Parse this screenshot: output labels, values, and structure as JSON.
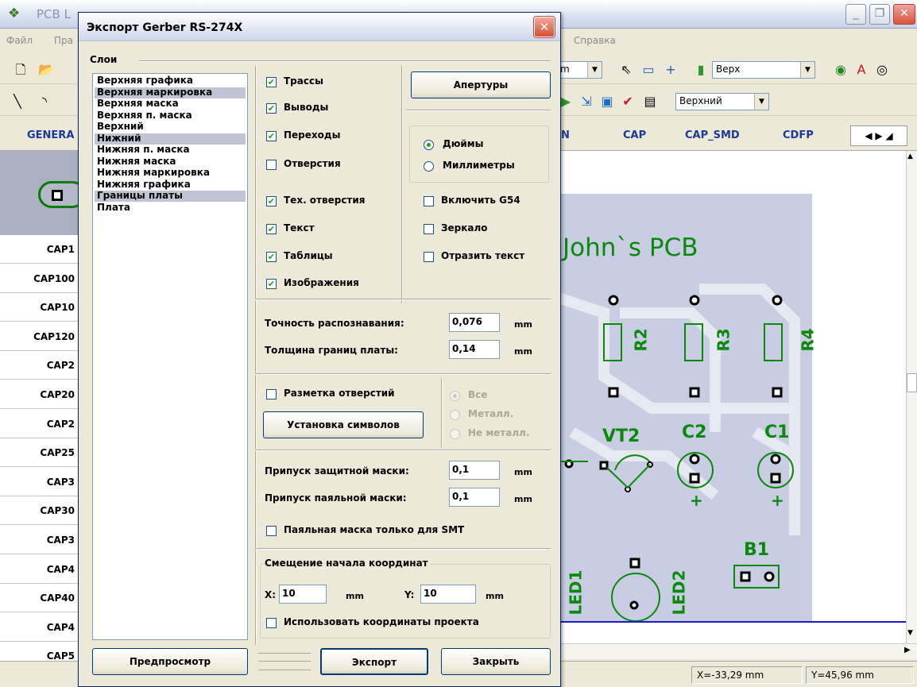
{
  "app": {
    "title": "PCB L",
    "menu": [
      "Файл",
      "Пра",
      "Справка"
    ],
    "toolbar": {
      "units_combo": "m",
      "side_combo": "Верх",
      "layer_combo": "Верхний"
    },
    "libtabs": [
      "GENERA",
      "N",
      "CAP",
      "CAP_SMD",
      "CDFP"
    ],
    "components": [
      "CAP1",
      "CAP100",
      "CAP10",
      "CAP120",
      "CAP2",
      "CAP20",
      "CAP2",
      "CAP25",
      "CAP3",
      "CAP30",
      "CAP3",
      "CAP4",
      "CAP40",
      "CAP4",
      "CAP5"
    ],
    "board": {
      "title": "John`s PCB",
      "refs": [
        "R2",
        "R3",
        "R4",
        "VT2",
        "C2",
        "C1",
        "B1",
        "LED1",
        "LED2"
      ],
      "polarity": "+"
    },
    "status": {
      "x": "X=-33,29 mm",
      "y": "Y=45,96 mm"
    }
  },
  "dialog": {
    "title": "Экспорт Gerber RS-274X",
    "close_glyph": "✕",
    "layers_label": "Слои",
    "layers": [
      {
        "name": "Верхняя графика",
        "selected": false
      },
      {
        "name": "Верхняя маркировка",
        "selected": true
      },
      {
        "name": "Верхняя маска",
        "selected": false
      },
      {
        "name": "Верхняя п. маска",
        "selected": false
      },
      {
        "name": "Верхний",
        "selected": false
      },
      {
        "name": "Нижний",
        "selected": true
      },
      {
        "name": "Нижняя п. маска",
        "selected": false
      },
      {
        "name": "Нижняя маска",
        "selected": false
      },
      {
        "name": "Нижняя маркировка",
        "selected": false
      },
      {
        "name": "Нижняя графика",
        "selected": false
      },
      {
        "name": "Границы платы",
        "selected": true
      },
      {
        "name": "Плата",
        "selected": false
      }
    ],
    "objects": [
      {
        "label": "Трассы",
        "checked": true
      },
      {
        "label": "Выводы",
        "checked": true
      },
      {
        "label": "Переходы",
        "checked": true
      },
      {
        "label": "Отверстия",
        "checked": false
      },
      {
        "label": "Тех. отверстия",
        "checked": true
      },
      {
        "label": "Текст",
        "checked": true
      },
      {
        "label": "Таблицы",
        "checked": true
      },
      {
        "label": "Изображения",
        "checked": true
      }
    ],
    "apertures_button": "Апертуры",
    "units": {
      "inches": "Дюймы",
      "millimeters": "Миллиметры",
      "selected": "inches"
    },
    "options": [
      {
        "label": "Включить G54",
        "checked": false
      },
      {
        "label": "Зеркало",
        "checked": false
      },
      {
        "label": "Отразить текст",
        "checked": false
      }
    ],
    "precision": {
      "label": "Точность распознавания:",
      "value": "0,076",
      "unit": "mm"
    },
    "border_width": {
      "label": "Толщина границ платы:",
      "value": "0,14",
      "unit": "mm"
    },
    "hole_marks": {
      "label": "Разметка отверстий",
      "checked": false,
      "symbols_button": "Установка символов",
      "radios": [
        "Все",
        "Металл.",
        "Не металл."
      ]
    },
    "solder_mask_clearance": {
      "label": "Припуск защитной маски:",
      "value": "0,1",
      "unit": "mm"
    },
    "paste_mask_clearance": {
      "label": "Припуск паяльной маски:",
      "value": "0,1",
      "unit": "mm"
    },
    "paste_smt_only": {
      "label": "Паяльная маска только для SMT",
      "checked": false
    },
    "offset": {
      "label": "Смещение начала координат",
      "x_label": "X:",
      "x_value": "10",
      "x_unit": "mm",
      "y_label": "Y:",
      "y_value": "10",
      "y_unit": "mm",
      "use_project": {
        "label": "Использовать координаты проекта",
        "checked": false
      }
    },
    "buttons": {
      "preview": "Предпросмотр",
      "export": "Экспорт",
      "close": "Закрыть"
    }
  }
}
